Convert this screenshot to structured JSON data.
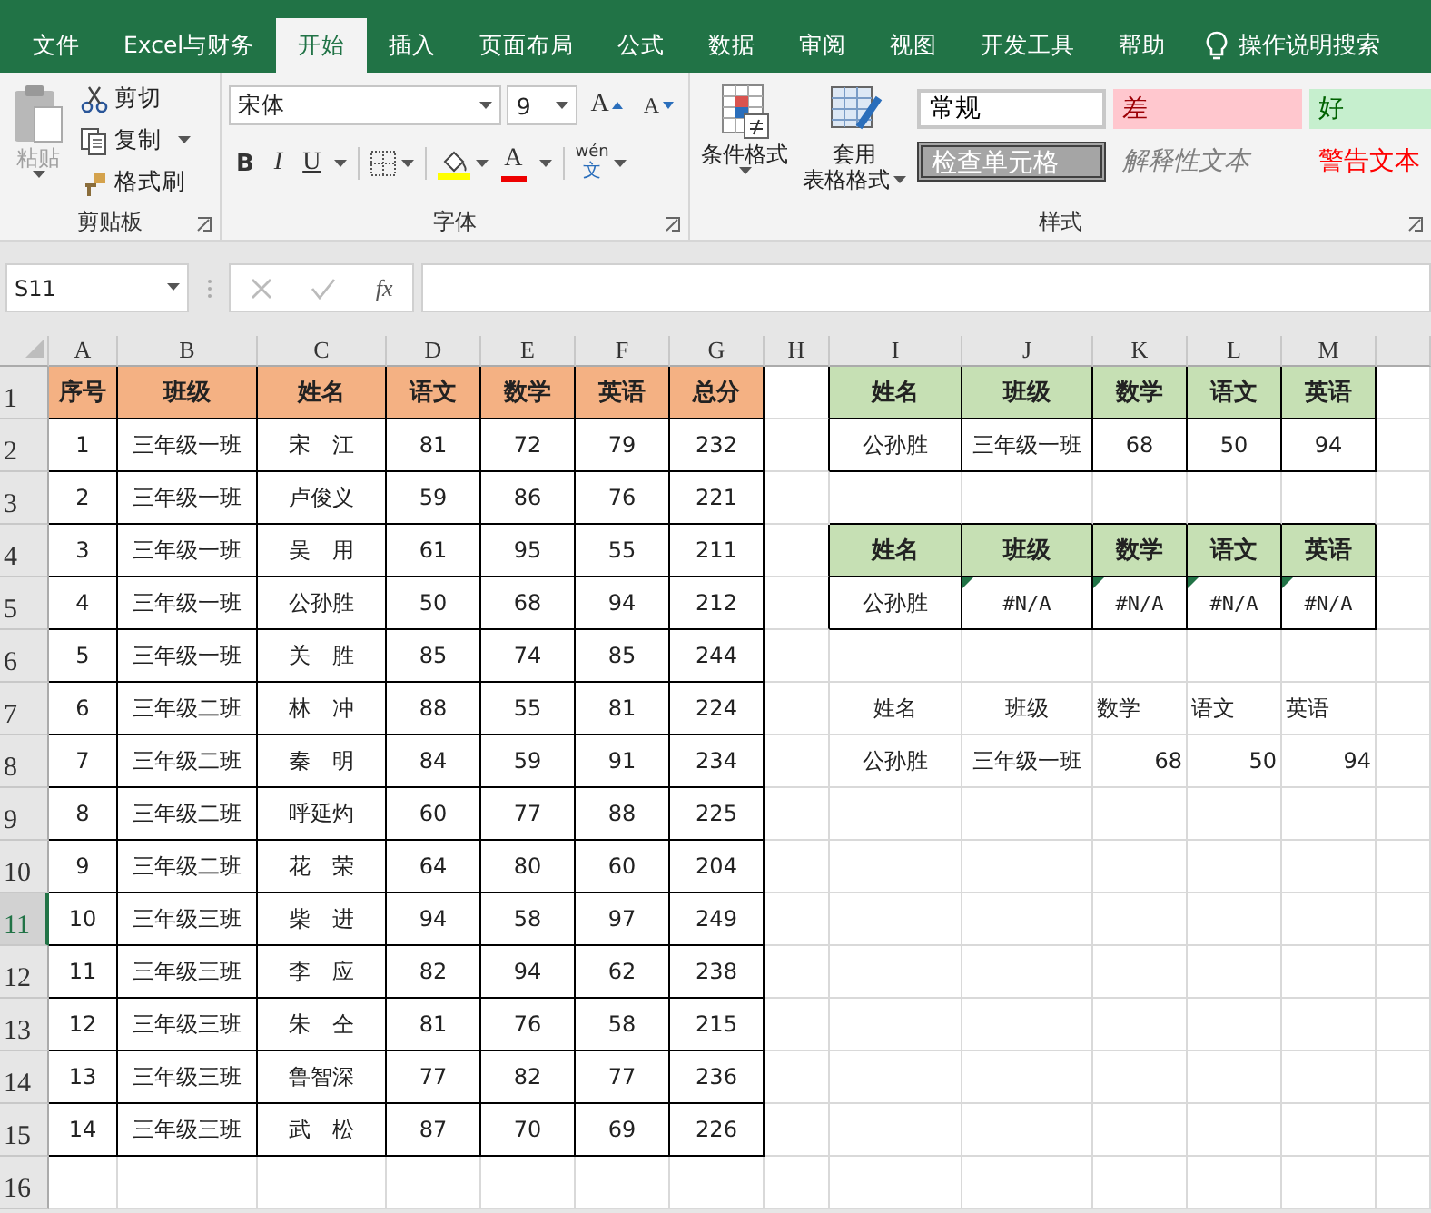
{
  "ribbon_tabs": [
    {
      "label": "文件",
      "selected": false
    },
    {
      "label": "Excel与财务",
      "selected": false
    },
    {
      "label": "开始",
      "selected": true
    },
    {
      "label": "插入",
      "selected": false
    },
    {
      "label": "页面布局",
      "selected": false
    },
    {
      "label": "公式",
      "selected": false
    },
    {
      "label": "数据",
      "selected": false
    },
    {
      "label": "审阅",
      "selected": false
    },
    {
      "label": "视图",
      "selected": false
    },
    {
      "label": "开发工具",
      "selected": false
    },
    {
      "label": "帮助",
      "selected": false
    }
  ],
  "tell_me": "操作说明搜索",
  "clipboard": {
    "paste": {
      "label": "粘贴",
      "disabled": true
    },
    "cut": "剪切",
    "copy": "复制",
    "format_painter": "格式刷",
    "group_label": "剪贴板"
  },
  "font": {
    "name": "宋体",
    "size": "9",
    "grow": "A",
    "shrink": "A",
    "bold": "B",
    "italic": "I",
    "underline": "U",
    "font_color": "A",
    "phonetic_top": "wén",
    "phonetic_bottom": "文",
    "group_label": "字体"
  },
  "styles": {
    "conditional_format": "条件格式",
    "table_format_top": "套用",
    "table_format_bottom": "表格格式",
    "group_label": "样式",
    "gallery": [
      {
        "label": "常规",
        "kind": "normal"
      },
      {
        "label": "差",
        "kind": "bad"
      },
      {
        "label": "好",
        "kind": "good"
      },
      {
        "label": "检查单元格",
        "kind": "check"
      },
      {
        "label": "解释性文本",
        "kind": "explanatory"
      },
      {
        "label": "警告文本",
        "kind": "warning"
      }
    ]
  },
  "formula_bar": {
    "name_box": "S11",
    "function_button": "fx"
  },
  "sheet": {
    "columns": [
      "A",
      "B",
      "C",
      "D",
      "E",
      "F",
      "G",
      "H",
      "I",
      "J",
      "K",
      "L",
      "M"
    ],
    "rows": [
      {
        "number": "1",
        "selected": false,
        "left": {
          "kind": "header",
          "cells": [
            "序号",
            "班级",
            "姓名",
            "语文",
            "数学",
            "英语",
            "总分"
          ]
        },
        "right": {
          "kind": "header",
          "cells": [
            {
              "text": "姓名"
            },
            {
              "text": "班级"
            },
            {
              "text": "数学"
            },
            {
              "text": "语文"
            },
            {
              "text": "英语"
            }
          ]
        }
      },
      {
        "number": "2",
        "selected": false,
        "left": {
          "kind": "bordered",
          "cells": [
            "1",
            "三年级一班",
            "宋　江",
            "81",
            "72",
            "79",
            "232"
          ]
        },
        "right": {
          "kind": "bordered",
          "cells": [
            {
              "text": "公孙胜"
            },
            {
              "text": "三年级一班"
            },
            {
              "text": "68"
            },
            {
              "text": "50"
            },
            {
              "text": "94"
            }
          ]
        }
      },
      {
        "number": "3",
        "selected": false,
        "left": {
          "kind": "bordered",
          "cells": [
            "2",
            "三年级一班",
            "卢俊义",
            "59",
            "86",
            "76",
            "221"
          ]
        }
      },
      {
        "number": "4",
        "selected": false,
        "left": {
          "kind": "bordered",
          "cells": [
            "3",
            "三年级一班",
            "吴　用",
            "61",
            "95",
            "55",
            "211"
          ]
        },
        "right": {
          "kind": "header",
          "cells": [
            {
              "text": "姓名"
            },
            {
              "text": "班级"
            },
            {
              "text": "数学"
            },
            {
              "text": "语文"
            },
            {
              "text": "英语"
            }
          ]
        }
      },
      {
        "number": "5",
        "selected": false,
        "left": {
          "kind": "bordered",
          "cells": [
            "4",
            "三年级一班",
            "公孙胜",
            "50",
            "68",
            "94",
            "212"
          ]
        },
        "right": {
          "kind": "bordered",
          "cells": [
            {
              "text": "公孙胜",
              "error": false
            },
            {
              "text": "#N/A",
              "error": true
            },
            {
              "text": "#N/A",
              "error": true
            },
            {
              "text": "#N/A",
              "error": true
            },
            {
              "text": "#N/A",
              "error": true
            }
          ]
        }
      },
      {
        "number": "6",
        "selected": false,
        "left": {
          "kind": "bordered",
          "cells": [
            "5",
            "三年级一班",
            "关　胜",
            "85",
            "74",
            "85",
            "244"
          ]
        }
      },
      {
        "number": "7",
        "selected": false,
        "left": {
          "kind": "bordered",
          "cells": [
            "6",
            "三年级二班",
            "林　冲",
            "88",
            "55",
            "81",
            "224"
          ]
        },
        "right": {
          "kind": "plain",
          "cells": [
            {
              "text": "姓名",
              "kind": "centered"
            },
            {
              "text": "班级",
              "kind": "centered"
            },
            {
              "text": "数学",
              "kind": "text"
            },
            {
              "text": "语文",
              "kind": "text"
            },
            {
              "text": "英语",
              "kind": "text"
            }
          ]
        }
      },
      {
        "number": "8",
        "selected": false,
        "left": {
          "kind": "bordered",
          "cells": [
            "7",
            "三年级二班",
            "秦　明",
            "84",
            "59",
            "91",
            "234"
          ]
        },
        "right": {
          "kind": "plain",
          "cells": [
            {
              "text": "公孙胜",
              "kind": "centered"
            },
            {
              "text": "三年级一班",
              "kind": "centered"
            },
            {
              "text": "68",
              "kind": "number"
            },
            {
              "text": "50",
              "kind": "number"
            },
            {
              "text": "94",
              "kind": "number"
            }
          ]
        }
      },
      {
        "number": "9",
        "selected": false,
        "left": {
          "kind": "bordered",
          "cells": [
            "8",
            "三年级二班",
            "呼延灼",
            "60",
            "77",
            "88",
            "225"
          ]
        }
      },
      {
        "number": "10",
        "selected": false,
        "left": {
          "kind": "bordered",
          "cells": [
            "9",
            "三年级二班",
            "花　荣",
            "64",
            "80",
            "60",
            "204"
          ]
        }
      },
      {
        "number": "11",
        "selected": true,
        "left": {
          "kind": "bordered",
          "cells": [
            "10",
            "三年级三班",
            "柴　进",
            "94",
            "58",
            "97",
            "249"
          ]
        }
      },
      {
        "number": "12",
        "selected": false,
        "left": {
          "kind": "bordered",
          "cells": [
            "11",
            "三年级三班",
            "李　应",
            "82",
            "94",
            "62",
            "238"
          ]
        }
      },
      {
        "number": "13",
        "selected": false,
        "left": {
          "kind": "bordered",
          "cells": [
            "12",
            "三年级三班",
            "朱　仝",
            "81",
            "76",
            "58",
            "215"
          ]
        }
      },
      {
        "number": "14",
        "selected": false,
        "left": {
          "kind": "bordered",
          "cells": [
            "13",
            "三年级三班",
            "鲁智深",
            "77",
            "82",
            "77",
            "236"
          ]
        }
      },
      {
        "number": "15",
        "selected": false,
        "left": {
          "kind": "bordered",
          "cells": [
            "14",
            "三年级三班",
            "武　松",
            "87",
            "70",
            "69",
            "226"
          ]
        }
      },
      {
        "number": "16",
        "selected": false
      }
    ]
  }
}
